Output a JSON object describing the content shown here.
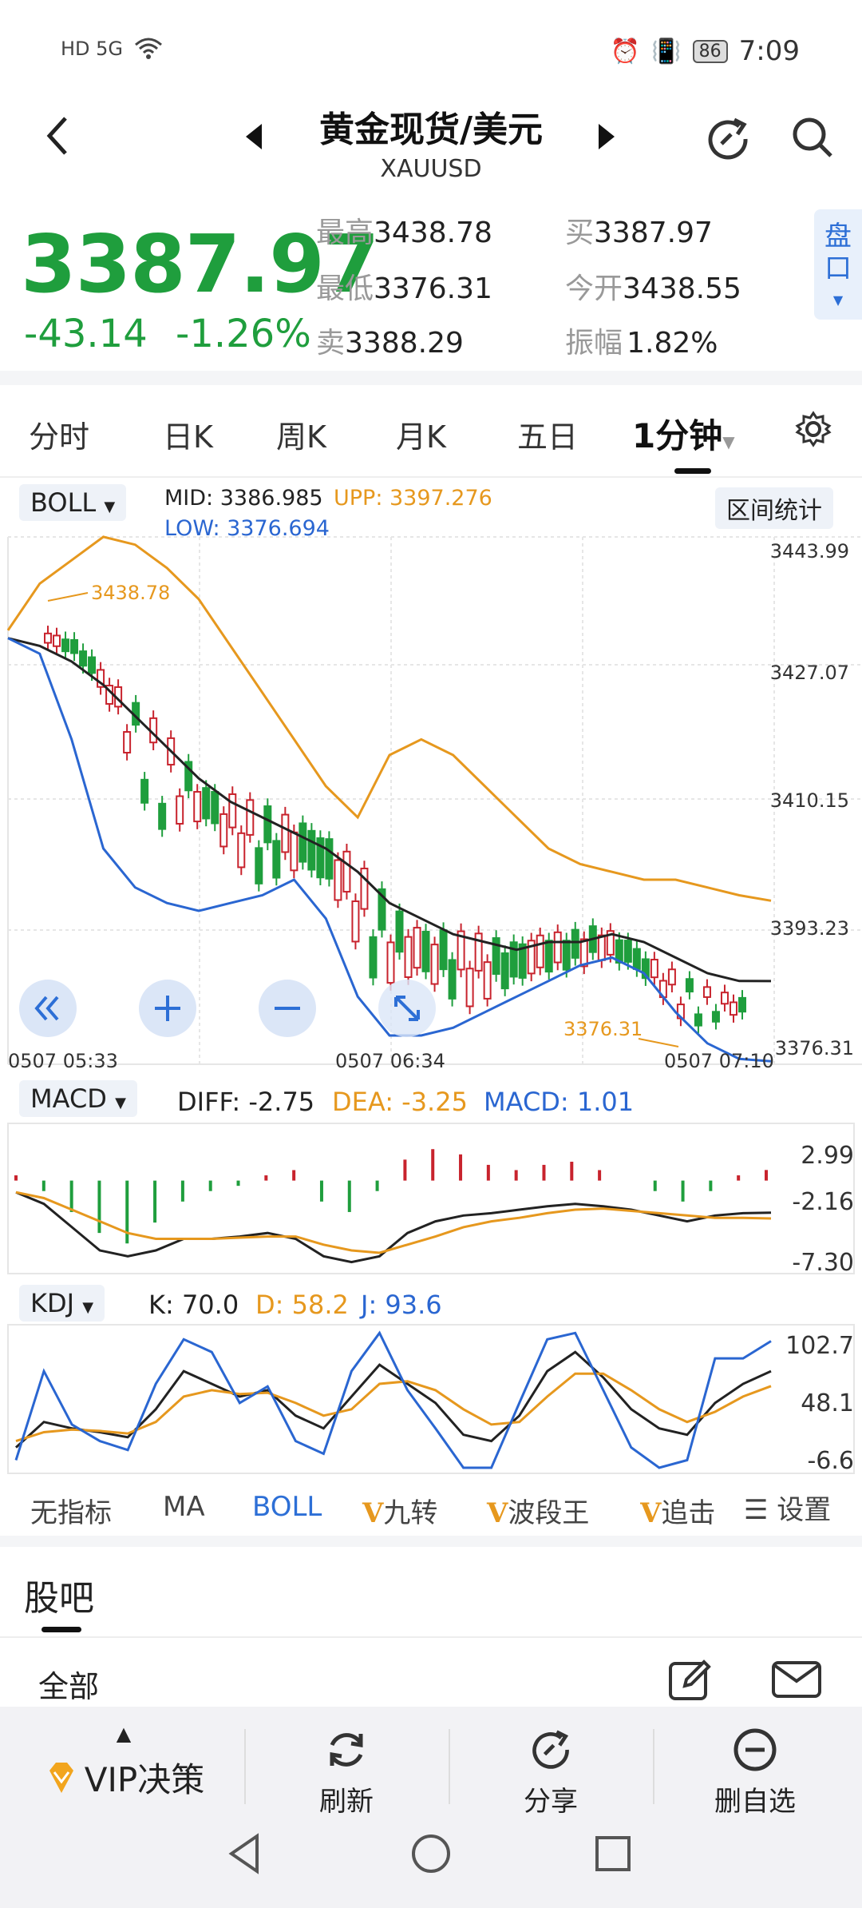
{
  "status_bar": {
    "left_icons": "HD 5G",
    "battery": "86",
    "time": "7:09"
  },
  "header": {
    "title": "黄金现货/美元",
    "symbol": "XAUUSD"
  },
  "quote": {
    "price": "3387.97",
    "change": "-43.14",
    "change_pct": "-1.26%",
    "high_label": "最高",
    "high": "3438.78",
    "low_label": "最低",
    "low": "3376.31",
    "sell_label": "卖",
    "sell": "3388.29",
    "buy_label": "买",
    "buy": "3387.97",
    "open_label": "今开",
    "open": "3438.55",
    "amp_label": "振幅",
    "amp": "1.82%",
    "panko": "盘口"
  },
  "tabs": [
    "分时",
    "日K",
    "周K",
    "月K",
    "五日",
    "1分钟"
  ],
  "boll": {
    "selector": "BOLL",
    "mid": "MID: 3386.985",
    "upp": "UPP: 3397.276",
    "low": "LOW: 3376.694",
    "stats_button": "区间统计",
    "y_ticks": [
      "3443.99",
      "3427.07",
      "3410.15",
      "3393.23",
      "3376.31"
    ],
    "x_ticks": [
      "0507  05:33",
      "0507  06:34",
      "0507  07:10"
    ],
    "high_mark": "3438.78",
    "low_mark": "3376.31"
  },
  "macd": {
    "selector": "MACD",
    "diff": "DIFF: -2.75",
    "dea": "DEA: -3.25",
    "macd": "MACD: 1.01",
    "y_ticks": [
      "2.99",
      "-2.16",
      "-7.30"
    ]
  },
  "kdj": {
    "selector": "KDJ",
    "k": "K: 70.0",
    "d": "D: 58.2",
    "j": "J: 93.6",
    "y_ticks": [
      "102.7",
      "48.1",
      "-6.6"
    ]
  },
  "indicator_tabs": {
    "none": "无指标",
    "ma": "MA",
    "boll": "BOLL",
    "v1": "九转",
    "v2": "波段王",
    "v3": "追击",
    "settings": "设置"
  },
  "forum": {
    "title": "股吧",
    "tab_all": "全部"
  },
  "bottom_nav": {
    "vip": "VIP决策",
    "refresh": "刷新",
    "share": "分享",
    "remove": "删自选"
  },
  "colors": {
    "up": "#c8232d",
    "down": "#1f9e3d",
    "upp": "#e6981e",
    "mid": "#222222",
    "low": "#2a66d1"
  },
  "chart_data": [
    {
      "type": "line",
      "title": "BOLL",
      "ylim": [
        3376.31,
        3443.99
      ],
      "yticks": [
        3443.99,
        3427.07,
        3410.15,
        3393.23,
        3376.31
      ],
      "xticks": [
        "0507  05:33",
        "0507  06:34",
        "0507  07:10"
      ],
      "series": [
        {
          "name": "UPP",
          "values": [
            3432,
            3438,
            3441,
            3444,
            3443,
            3440,
            3436,
            3430,
            3424,
            3418,
            3412,
            3408,
            3416,
            3418,
            3416,
            3412,
            3408,
            3404,
            3402,
            3401,
            3400,
            3400,
            3399,
            3398,
            3397.3
          ]
        },
        {
          "name": "MID",
          "values": [
            3431,
            3430,
            3428,
            3425,
            3421,
            3417,
            3413,
            3410,
            3408,
            3406,
            3404,
            3401,
            3397,
            3395,
            3393,
            3392,
            3391,
            3392,
            3392,
            3393,
            3392,
            3390,
            3388,
            3387,
            3386.985
          ]
        },
        {
          "name": "LOW",
          "values": [
            3431,
            3429,
            3418,
            3404,
            3399,
            3397,
            3396,
            3397,
            3398,
            3400,
            3395,
            3385,
            3380,
            3380,
            3381,
            3383,
            3385,
            3387,
            3389,
            3390,
            3388,
            3383,
            3379,
            3377,
            3376.694
          ]
        }
      ]
    },
    {
      "type": "bar",
      "title": "MACD",
      "ylim": [
        -7.3,
        2.99
      ],
      "series": [
        {
          "name": "MACD",
          "values": [
            0.5,
            -1,
            -3,
            -5,
            -6,
            -4,
            -2,
            -1,
            -0.5,
            0.5,
            1,
            -2,
            -3,
            -1,
            2,
            3,
            2.5,
            1.5,
            1,
            1.5,
            1.8,
            1,
            0,
            -1,
            -2,
            -1,
            0.5,
            1.01
          ]
        },
        {
          "name": "DIFF",
          "values": [
            -1,
            -2,
            -4,
            -6,
            -6.5,
            -6,
            -5,
            -5,
            -4.8,
            -4.5,
            -5,
            -6.5,
            -7,
            -6.5,
            -4.5,
            -3.5,
            -3,
            -2.8,
            -2.5,
            -2.2,
            -2,
            -2.2,
            -2.5,
            -3,
            -3.5,
            -3,
            -2.8,
            -2.75
          ]
        },
        {
          "name": "DEA",
          "values": [
            -1,
            -1.5,
            -2.5,
            -3.5,
            -4.5,
            -5,
            -5,
            -5,
            -4.9,
            -4.8,
            -4.8,
            -5.5,
            -6,
            -6.2,
            -5.5,
            -4.8,
            -4,
            -3.5,
            -3.2,
            -2.8,
            -2.5,
            -2.4,
            -2.6,
            -2.8,
            -3,
            -3.2,
            -3.2,
            -3.25
          ]
        }
      ]
    },
    {
      "type": "line",
      "title": "KDJ",
      "ylim": [
        -6.6,
        102.7
      ],
      "series": [
        {
          "name": "K",
          "values": [
            10,
            30,
            25,
            22,
            18,
            40,
            70,
            60,
            50,
            55,
            35,
            25,
            50,
            75,
            60,
            45,
            20,
            15,
            35,
            70,
            85,
            65,
            40,
            25,
            20,
            45,
            60,
            70.0
          ]
        },
        {
          "name": "D",
          "values": [
            15,
            22,
            24,
            23,
            21,
            30,
            50,
            55,
            52,
            53,
            45,
            35,
            40,
            60,
            62,
            55,
            40,
            28,
            30,
            50,
            68,
            68,
            55,
            40,
            30,
            38,
            50,
            58.2
          ]
        },
        {
          "name": "J",
          "values": [
            0,
            70,
            28,
            15,
            8,
            60,
            95,
            85,
            45,
            58,
            15,
            5,
            70,
            100,
            55,
            25,
            -6,
            -6,
            45,
            95,
            100,
            55,
            10,
            -6,
            0,
            80,
            80,
            93.6
          ]
        }
      ]
    }
  ]
}
